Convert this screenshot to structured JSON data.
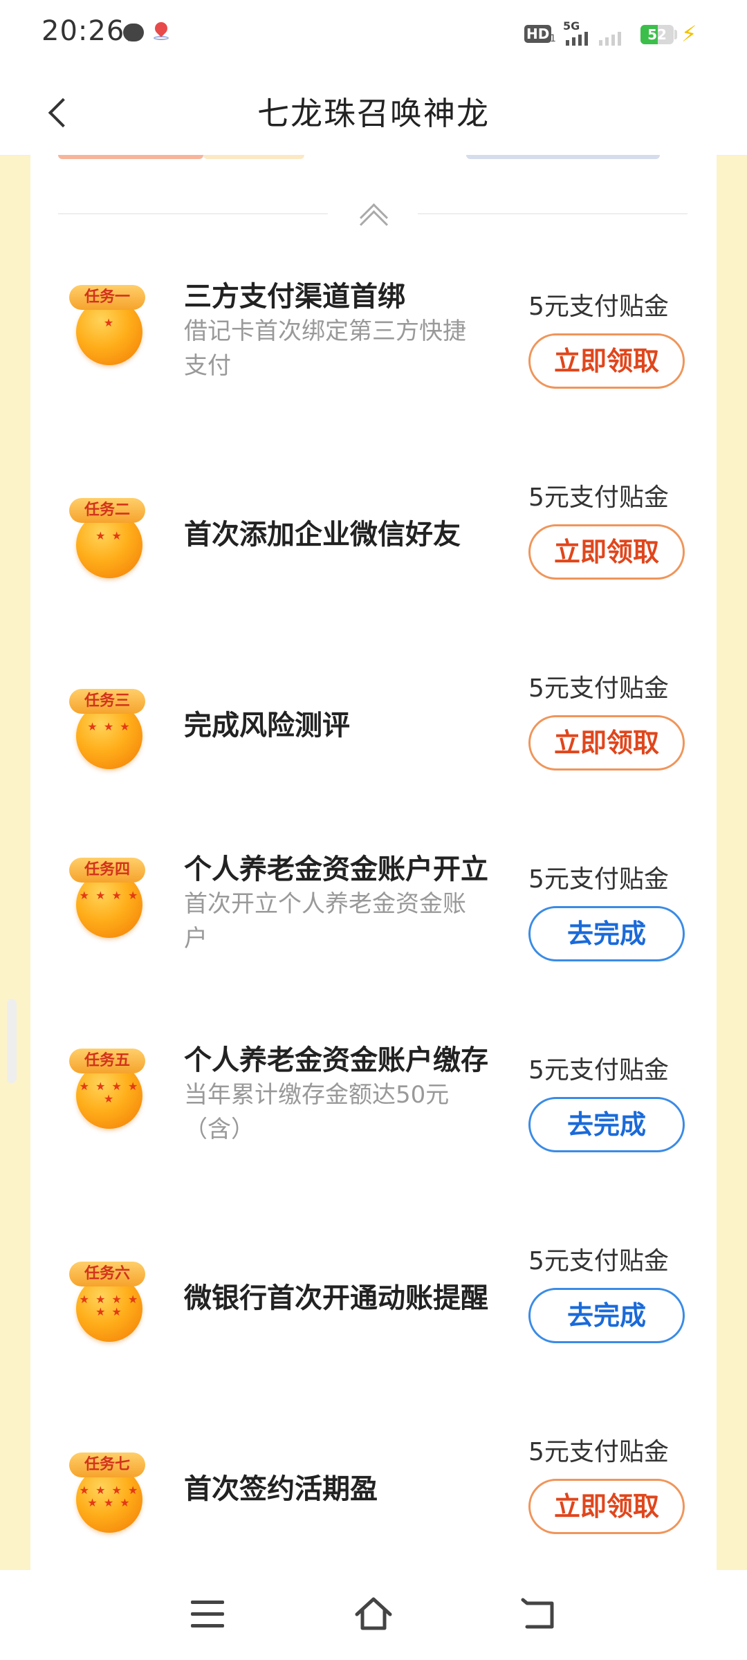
{
  "status_bar": {
    "time": "20:26",
    "hd_label": "HD",
    "hd_sub": "1",
    "network": "5G",
    "battery_level": "52",
    "battery_fraction": 0.52,
    "icons": [
      "message-icon",
      "location-icon",
      "signal-icon",
      "charging-icon"
    ]
  },
  "header": {
    "title": "七龙珠召唤神龙",
    "back_icon": "chevron-left-icon"
  },
  "colors": {
    "page_bg": "#fdf3c9",
    "claim_border": "#f0955a",
    "claim_text": "#e0461c",
    "go_border": "#3a8be6",
    "go_text": "#1a6ad9",
    "badge": "#f6a32c",
    "ball": "#ffae1a"
  },
  "tasks": [
    {
      "badge": "任务一",
      "stars": "★",
      "name": "三方支付渠道首绑",
      "desc": "借记卡首次绑定第三方快捷支付",
      "reward": "5元支付贴金",
      "button": "立即领取",
      "state": "claim"
    },
    {
      "badge": "任务二",
      "stars": "★ ★",
      "name": "首次添加企业微信好友",
      "desc": "",
      "reward": "5元支付贴金",
      "button": "立即领取",
      "state": "claim"
    },
    {
      "badge": "任务三",
      "stars": "★ ★ ★",
      "name": "完成风险测评",
      "desc": "",
      "reward": "5元支付贴金",
      "button": "立即领取",
      "state": "claim"
    },
    {
      "badge": "任务四",
      "stars": "★ ★ ★ ★",
      "name": "个人养老金资金账户开立",
      "desc": "首次开立个人养老金资金账户",
      "reward": "5元支付贴金",
      "button": "去完成",
      "state": "go"
    },
    {
      "badge": "任务五",
      "stars": "★ ★ ★ ★ ★",
      "name": "个人养老金资金账户缴存",
      "desc": "当年累计缴存金额达50元（含）",
      "reward": "5元支付贴金",
      "button": "去完成",
      "state": "go"
    },
    {
      "badge": "任务六",
      "stars": "★ ★ ★ ★ ★ ★",
      "name": "微银行首次开通动账提醒",
      "desc": "",
      "reward": "5元支付贴金",
      "button": "去完成",
      "state": "go"
    },
    {
      "badge": "任务七",
      "stars": "★ ★ ★ ★ ★ ★ ★",
      "name": "首次签约活期盈",
      "desc": "",
      "reward": "5元支付贴金",
      "button": "立即领取",
      "state": "claim"
    }
  ],
  "system_nav": [
    "menu-icon",
    "home-icon",
    "back-icon"
  ]
}
